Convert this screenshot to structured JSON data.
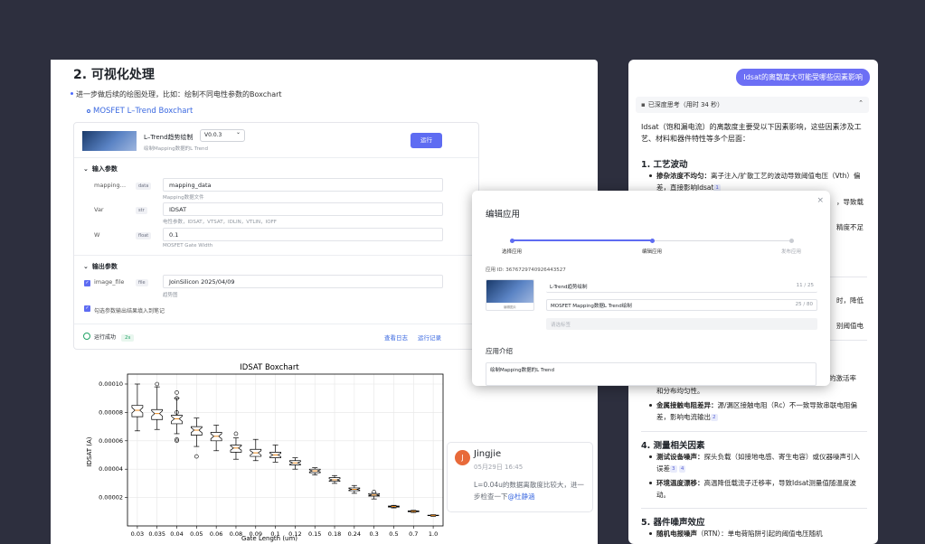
{
  "doc": {
    "heading": "2. 可视化处理",
    "bullet": "进一步做后续的绘图处理，比如：绘制不同电性参数的Boxchart",
    "sublink": "MOSFET L–Trend Boxchart"
  },
  "app_card": {
    "title": "L–Trend趋势绘制",
    "version": "V0.0.3",
    "desc": "绘制Mapping数据的L Trend",
    "run": "运行",
    "input_section": "输入参数",
    "output_section": "输出参数",
    "inputs": [
      {
        "name": "mapping…",
        "type": "data",
        "value": "mapping_data",
        "hint": "Mapping数据文件"
      },
      {
        "name": "Var",
        "type": "str",
        "value": "IDSAT",
        "hint": "电性参数，IDSAT，VTSAT，IDLIN，VTLIN，IOFF"
      },
      {
        "name": "W",
        "type": "float",
        "value": "0.1",
        "hint": "MOSFET Gate Width"
      }
    ],
    "outputs": [
      {
        "name": "image_file",
        "type": "file",
        "value": "JoinSilicon 2025/04/09",
        "hint": "趋势图"
      }
    ],
    "checkbox_label": "勾选参数输出结果填入到笔记",
    "status": "运行成功",
    "duration": "2s",
    "view_log": "查看日志",
    "run_records": "运行记录"
  },
  "chart_data": {
    "type": "boxplot",
    "title": "IDSAT Boxchart",
    "xlabel": "Gate Length (um)",
    "ylabel": "IDSAT (A)",
    "categories": [
      "0.03",
      "0.035",
      "0.04",
      "0.05",
      "0.06",
      "0.08",
      "0.09",
      "0.1",
      "0.12",
      "0.15",
      "0.18",
      "0.24",
      "0.3",
      "0.5",
      "0.7",
      "1.0"
    ],
    "yticks": [
      "0.00002",
      "0.00004",
      "0.00006",
      "0.00008",
      "0.00010"
    ],
    "ylim": [
      0,
      0.000107
    ],
    "boxes": [
      {
        "min": 6.7e-05,
        "q1": 7.7e-05,
        "median": 8.15e-05,
        "q3": 8.5e-05,
        "max": 0.0001
      },
      {
        "min": 6.8e-05,
        "q1": 7.5e-05,
        "median": 7.92e-05,
        "q3": 8.2e-05,
        "max": 9.8e-05,
        "outliers": [
          0.0001
        ]
      },
      {
        "min": 6.5e-05,
        "q1": 7.2e-05,
        "median": 7.55e-05,
        "q3": 7.8e-05,
        "max": 9e-05,
        "outliers": [
          9.4e-05,
          9e-05,
          8e-05,
          6.1e-05,
          6e-05
        ]
      },
      {
        "min": 5.6e-05,
        "q1": 6.4e-05,
        "median": 6.75e-05,
        "q3": 7e-05,
        "max": 7.6e-05,
        "outliers": [
          4.9e-05
        ]
      },
      {
        "min": 5.3e-05,
        "q1": 6e-05,
        "median": 6.32e-05,
        "q3": 6.6e-05,
        "max": 7.1e-05
      },
      {
        "min": 4.7e-05,
        "q1": 5.2e-05,
        "median": 5.49e-05,
        "q3": 5.7e-05,
        "max": 6.2e-05,
        "outliers": [
          6.5e-05
        ]
      },
      {
        "min": 4.6e-05,
        "q1": 4.9e-05,
        "median": 5.15e-05,
        "q3": 5.4e-05,
        "max": 6.1e-05
      },
      {
        "min": 4.5e-05,
        "q1": 4.8e-05,
        "median": 5e-05,
        "q3": 5.2e-05,
        "max": 5.7e-05
      },
      {
        "min": 4e-05,
        "q1": 4.3e-05,
        "median": 4.44e-05,
        "q3": 4.6e-05,
        "max": 4.8e-05
      },
      {
        "min": 3.6e-05,
        "q1": 3.75e-05,
        "median": 3.88e-05,
        "q3": 4e-05,
        "max": 4.1e-05
      },
      {
        "min": 3e-05,
        "q1": 3.15e-05,
        "median": 3.25e-05,
        "q3": 3.4e-05,
        "max": 3.55e-05
      },
      {
        "min": 2.3e-05,
        "q1": 2.48e-05,
        "median": 2.58e-05,
        "q3": 2.68e-05,
        "max": 2.85e-05
      },
      {
        "min": 1.9e-05,
        "q1": 2.1e-05,
        "median": 2.18e-05,
        "q3": 2.28e-05,
        "max": 2.3e-05,
        "outliers": [
          2.4e-05
        ]
      },
      {
        "min": 1.27e-05,
        "q1": 1.33e-05,
        "median": 1.37e-05,
        "q3": 1.4e-05,
        "max": 1.45e-05
      },
      {
        "min": 9.5e-06,
        "q1": 1e-05,
        "median": 1.03e-05,
        "q3": 1.06e-05,
        "max": 1.1e-05
      },
      {
        "min": 6.8e-06,
        "q1": 7.2e-06,
        "median": 7.4e-06,
        "q3": 7.6e-06,
        "max": 7.9e-06
      }
    ],
    "grid": true
  },
  "comment": {
    "initial": "J",
    "name": "Jingjie",
    "date": "05月29日 16:45",
    "text": "L=0.04u的数据离散度比较大，进一步检查一下",
    "mention": "@杜静涵"
  },
  "modal": {
    "title": "编辑应用",
    "close": "×",
    "steps": [
      "选择应用",
      "编辑应用",
      "发布应用"
    ],
    "app_id_label": "应用 ID: 3676729740926443527",
    "thumb_caption": "编辑图片",
    "name_value": "L-Trend趋势绘制",
    "name_count": "11 / 25",
    "desc_value": "MOSFET Mapping数据L Trend绘制",
    "desc_count": "25 / 80",
    "tags_placeholder": "请选标签",
    "intro_label": "应用介绍",
    "intro_value": "绘制Mapping数据的L Trend"
  },
  "chat": {
    "question": "Idsat的离散度大可能受哪些因素影响",
    "thinking": "已深度思考（用时 34 秒）",
    "intro": "Idsat（饱和漏电流）的离散度主要受以下因素影响，这些因素涉及工艺、材料和器件特性等多个层面：",
    "s1": "1. 工艺波动",
    "b1_title": "掺杂浓度不均匀：",
    "b1_text": "离子注入/扩散工艺的波动导致阈值电压（Vth）偏差，直接影响Idsat",
    "b1_cite": "1",
    "frag1": "，导致载",
    "frag2": "精度不足",
    "frag3": "时，降低",
    "frag4": "别阈值电",
    "frag5": "的激活率",
    "frag6": "和分布均匀性。",
    "b_contact_title": "金属接触电阻差异：",
    "b_contact_text": "源/漏区接触电阻（Rc）不一致导致串联电阻偏差，影响电流输出",
    "b_contact_cite": "2",
    "s3": "4. 测量相关因素",
    "b3a_title": "测试设备噪声：",
    "b3a_text": "探头负载（如接地电感、寄生电容）或仪器噪声引入误差",
    "b3a_cites": [
      "3",
      "4"
    ],
    "b3b_title": "环境温度漂移：",
    "b3b_text": "高温降低载流子迁移率，导致Idsat测量值随温度波动。",
    "s4": "5. 器件噪声效应",
    "b4_title": "随机电报噪声",
    "b4_text": "（RTN）：单电荷陷阱引起的阈值电压随机"
  }
}
